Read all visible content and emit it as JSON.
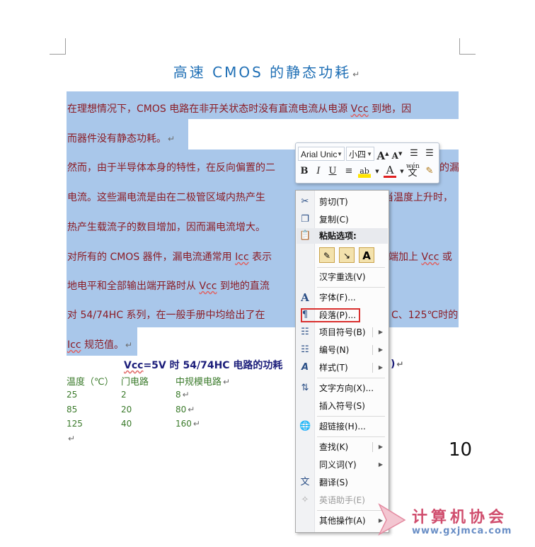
{
  "document": {
    "title": "高速 CMOS 的静态功耗",
    "paragraph_mark": "↵",
    "paragraphs": [
      {
        "l1_a": "在理想情况下，CMOS 电路在非开关状态时没有直流电流从电源 ",
        "l1_vcc": "Vcc",
        "l1_b": " 到地，因",
        "l2": "而器件没有静态功耗。"
      },
      {
        "l1": "然而，由于半导体本身的特性，在反向偏置的二",
        "l1_end": "的漏",
        "l2_a": "电流。这些漏电流是由在二极管区域内热产生",
        "l2_end": "当温度上升时，",
        "l3": "热产生载流子的数目增加，因而漏电流增大。"
      },
      {
        "l1_a": "对所有的 CMOS 器件，漏电流通常用 ",
        "l1_icc": "Icc",
        "l1_b": " 表示",
        "l1_c": "端加上 ",
        "l1_vcc": "Vcc",
        "l1_d": " 或",
        "l2_a": "地电平和全部输出端开路时从 ",
        "l2_vcc": "Vcc",
        "l2_b": " 到地的直流"
      },
      {
        "l1_a": "对 54/74HC 系列，在一般手册中均给出了在",
        "l1_b": "C、125℃时的",
        "l2_icc": "Icc",
        "l2_b": " 规范值。"
      }
    ],
    "table": {
      "title_vcc": "Vcc",
      "title_rest": "=5V 时 54/74HC 电路的功耗",
      "title_end": ")",
      "headers": [
        "温度（℃）",
        "门电路",
        "中规模电路"
      ],
      "rows": [
        [
          "25",
          "2",
          "8"
        ],
        [
          "85",
          "20",
          "80"
        ],
        [
          "125",
          "40",
          "160"
        ]
      ]
    },
    "page_number": "10"
  },
  "mini_toolbar": {
    "font_name": "Arial Unic",
    "font_size": "小四",
    "grow_font": "A",
    "shrink_font": "A",
    "bold": "B",
    "italic": "I",
    "underline": "U",
    "font_color_glyph": "A",
    "highlight_glyph": "ab",
    "pinyin_glyph": "wén",
    "pinyin_char": "文"
  },
  "context_menu": {
    "items": [
      {
        "label": "剪切(T)",
        "icon": "scissors-icon"
      },
      {
        "label": "复制(C)",
        "icon": "copy-icon"
      },
      {
        "label": "粘贴选项:",
        "icon": "paste-icon"
      },
      {
        "label": "汉字重选(V)",
        "icon": ""
      },
      {
        "label": "字体(F)...",
        "icon": "font-icon"
      },
      {
        "label": "段落(P)...",
        "icon": "paragraph-icon"
      },
      {
        "label": "项目符号(B)",
        "icon": "bullets-icon"
      },
      {
        "label": "编号(N)",
        "icon": "numbering-icon"
      },
      {
        "label": "样式(T)",
        "icon": "styles-icon"
      },
      {
        "label": "文字方向(X)...",
        "icon": "text-direction-icon"
      },
      {
        "label": "插入符号(S)",
        "icon": ""
      },
      {
        "label": "超链接(H)...",
        "icon": "hyperlink-icon"
      },
      {
        "label": "查找(K)",
        "icon": ""
      },
      {
        "label": "同义词(Y)",
        "icon": ""
      },
      {
        "label": "翻译(S)",
        "icon": "translate-icon"
      },
      {
        "label": "英语助手(E)",
        "icon": "english-assistant-icon"
      },
      {
        "label": "其他操作(A)",
        "icon": ""
      }
    ],
    "paste_options": [
      "A"
    ]
  },
  "watermark": {
    "line1": "计算机协会",
    "line2": "www.gxjmca.com"
  },
  "colors": {
    "selection": "#a9c7ea",
    "highlight_box": "#d9302e",
    "title": "#1f6fb5"
  }
}
